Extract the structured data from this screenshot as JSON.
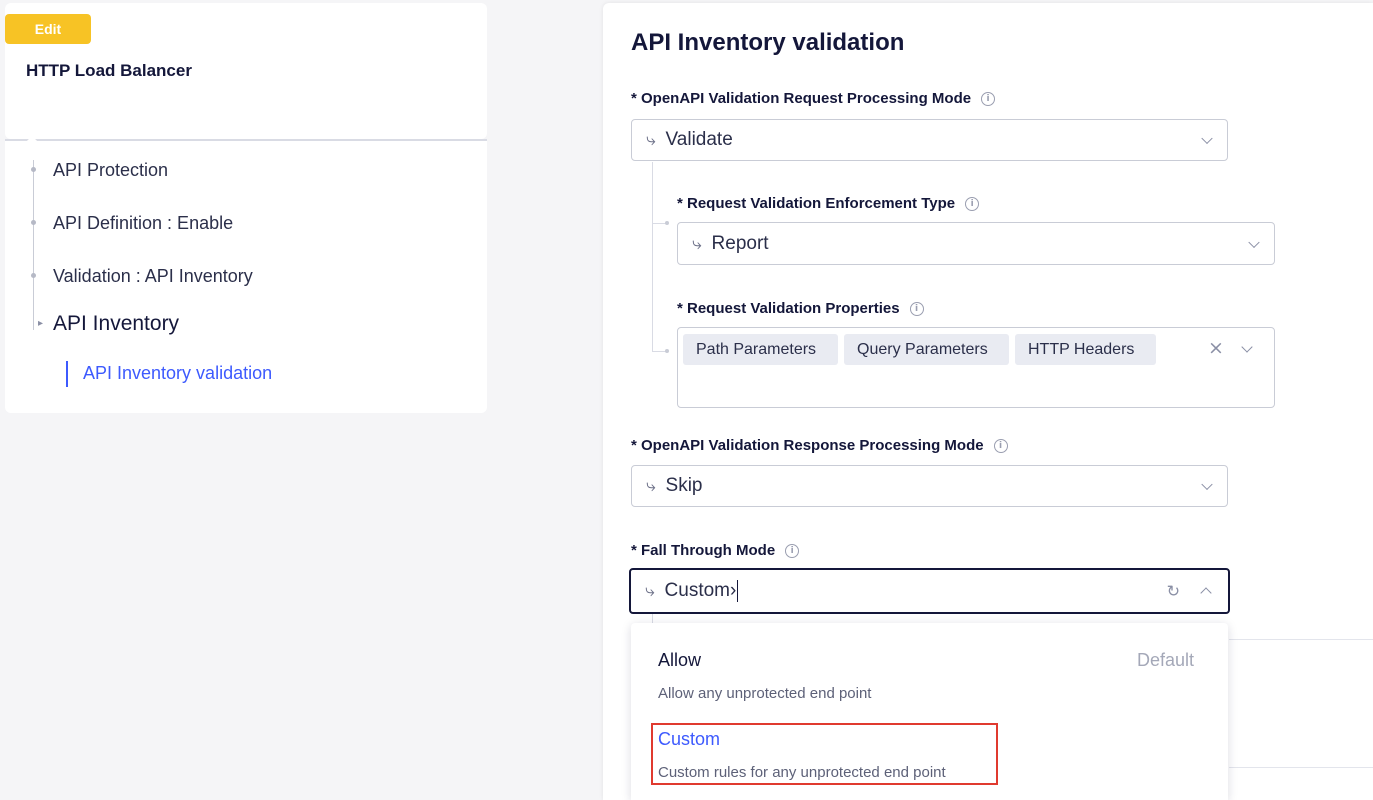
{
  "left_panel": {
    "edit_badge": "Edit",
    "title": "HTTP Load Balancer",
    "nav": [
      {
        "label": "API Protection"
      },
      {
        "label": "API Definition : Enable"
      },
      {
        "label": "Validation : API Inventory"
      }
    ],
    "active_group": "API Inventory",
    "active_item": "API Inventory validation"
  },
  "form": {
    "title": "API Inventory validation",
    "request_mode": {
      "label": "* OpenAPI Validation Request Processing Mode",
      "value": "Validate"
    },
    "enforcement_type": {
      "label": "* Request Validation Enforcement Type",
      "value": "Report"
    },
    "validation_properties": {
      "label": "* Request Validation Properties",
      "chips": [
        "Path Parameters",
        "Query Parameters",
        "HTTP Headers"
      ]
    },
    "response_mode": {
      "label": "* OpenAPI Validation Response Processing Mode",
      "value": "Skip"
    },
    "fall_through": {
      "label": "* Fall Through Mode",
      "input_value": "Custom›"
    },
    "dropdown": {
      "options": [
        {
          "label": "Allow",
          "description": "Allow any unprotected end point",
          "tag": "Default"
        },
        {
          "label": "Custom",
          "description": "Custom rules for any unprotected end point",
          "tag": ""
        }
      ]
    }
  },
  "icons": {
    "mode": "branch-icon",
    "info": "info-icon",
    "clear": "close-icon",
    "refresh": "refresh-icon",
    "chevron": "chevron-down-icon"
  },
  "colors": {
    "accent": "#3d5afe",
    "edit_badge": "#f7c325",
    "highlight": "#e03a2f"
  }
}
